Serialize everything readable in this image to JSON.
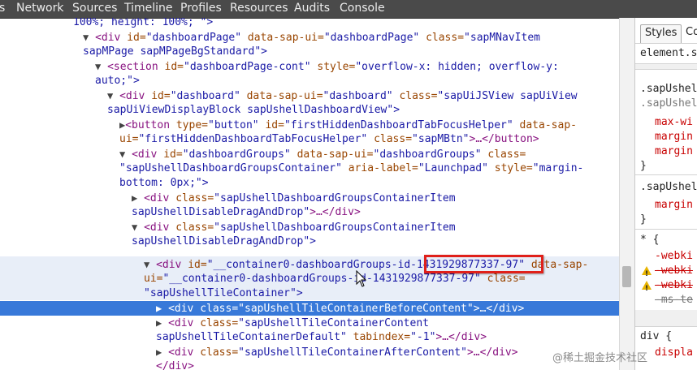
{
  "tabs": [
    "s",
    "Network",
    "Sources",
    "Timeline",
    "Profiles",
    "Resources",
    "Audits",
    "Console"
  ],
  "dom": {
    "line0": "100%; height: 100%; \">",
    "line1": {
      "tag_open": "<div ",
      "a1": "id=",
      "v1": "\"dashboardPage\"",
      "a2": " data-sap-ui=",
      "v2": "\"dashboardPage\"",
      "a3": " class=",
      "v3": "\"sapMNavItem"
    },
    "line2": "sapMPage sapMPageBgStandard\">",
    "line3": {
      "tag_open": "<section ",
      "a1": "id=",
      "v1": "\"dashboardPage-cont\"",
      "a2": " style=",
      "v2": "\"overflow-x: hidden; overflow-y:"
    },
    "line4": "auto;\">",
    "line5": {
      "tag_open": "<div ",
      "a1": "id=",
      "v1": "\"dashboard\"",
      "a2": " data-sap-ui=",
      "v2": "\"dashboard\"",
      "a3": " class=",
      "v3": "\"sapUiJSView sapUiView"
    },
    "line6": "sapUiViewDisplayBlock sapUshellDashboardView\">",
    "line7": {
      "tag_open": "<button ",
      "a1": "type=",
      "v1": "\"button\"",
      "a2": " id=",
      "v2": "\"firstHiddenDashboardTabFocusHelper\"",
      "a3": " data-sap-"
    },
    "line8": {
      "a1": "ui=",
      "v1": "\"firstHiddenDashboardTabFocusHelper\"",
      "a2": " class=",
      "v2": "\"sapMBtn\"",
      "tail": ">…</button>"
    },
    "line9": {
      "tag_open": "<div ",
      "a1": "id=",
      "v1": "\"dashboardGroups\"",
      "a2": " data-sap-ui=",
      "v2": "\"dashboardGroups\"",
      "a3": " class="
    },
    "line10": {
      "v1": "\"sapUshellDashboardGroupsContainer\"",
      "a1": " aria-label=",
      "v2": "\"Launchpad\"",
      "a2": " style=",
      "v3": "\"margin-"
    },
    "line11": "bottom: 0px;\">",
    "line12": {
      "tag_open": "<div ",
      "a1": "class=",
      "v1": "\"sapUshellDashboardGroupsContainerItem"
    },
    "line13": {
      "v1": "sapUshellDisableDragAndDrop\"",
      "tail": ">…</div>"
    },
    "line14": {
      "tag_open": "<div ",
      "a1": "class=",
      "v1": "\"sapUshellDashboardGroupsContainerItem"
    },
    "line15": "sapUshellDisableDragAndDrop\">",
    "line16": {
      "tag_open": "<div ",
      "a1": "id=",
      "v1": "\"__container0-dashboardGroups-id-",
      "highlight": "1431929877337-97",
      "v1b": "\"",
      "a2": " data-sap-"
    },
    "line17": {
      "a1": "ui=",
      "v1": "\"__container0-dashboardGroups-id-1431929877337-97\"",
      "a2": " class="
    },
    "line18": "\"sapUshellTileContainer\">",
    "line19": {
      "tag_open": "<div ",
      "a1": "class=",
      "v1": "\"sapUshellTileContainerBeforeContent\"",
      "tail": ">…</div>"
    },
    "line20": {
      "tag_open": "<div ",
      "a1": "class=",
      "v1": "\"sapUshellTileContainerContent"
    },
    "line21": {
      "v1": "sapUshellTileContainerDefault\"",
      "a1": " tabindex=",
      "v2": "\"-1\"",
      "tail": ">…</div>"
    },
    "line22": {
      "tag_open": "<div ",
      "a1": "class=",
      "v1": "\"sapUshellTileContainerAfterContent\"",
      "tail": ">…</div>"
    },
    "line23": "</div>"
  },
  "styles_pane": {
    "tab_active": "Styles",
    "tab_second": "Co",
    "element_style": "element.s",
    "r1_sel1": ".sapUshel",
    "r1_sel2": ".sapUshel",
    "r1_p1": "max-wi",
    "r1_p2": "margin",
    "r1_p3": "margin",
    "brace_close": "}",
    "r2_sel": ".sapUshel",
    "r2_p1": "margin",
    "r3_sel": "* {",
    "r3_p1": "-webki",
    "r3_p2": "-webki",
    "r3_p3": "-webki",
    "r3_p4": "-ms-te",
    "r4_sel": "div {",
    "r4_p1": "displa"
  },
  "watermark": "@稀土掘金技术社区",
  "colors": {
    "selection": "#3879d9",
    "highlight_box": "#e0201a",
    "tag": "#881280",
    "attr_name": "#994500",
    "attr_value": "#1a1aa6"
  }
}
